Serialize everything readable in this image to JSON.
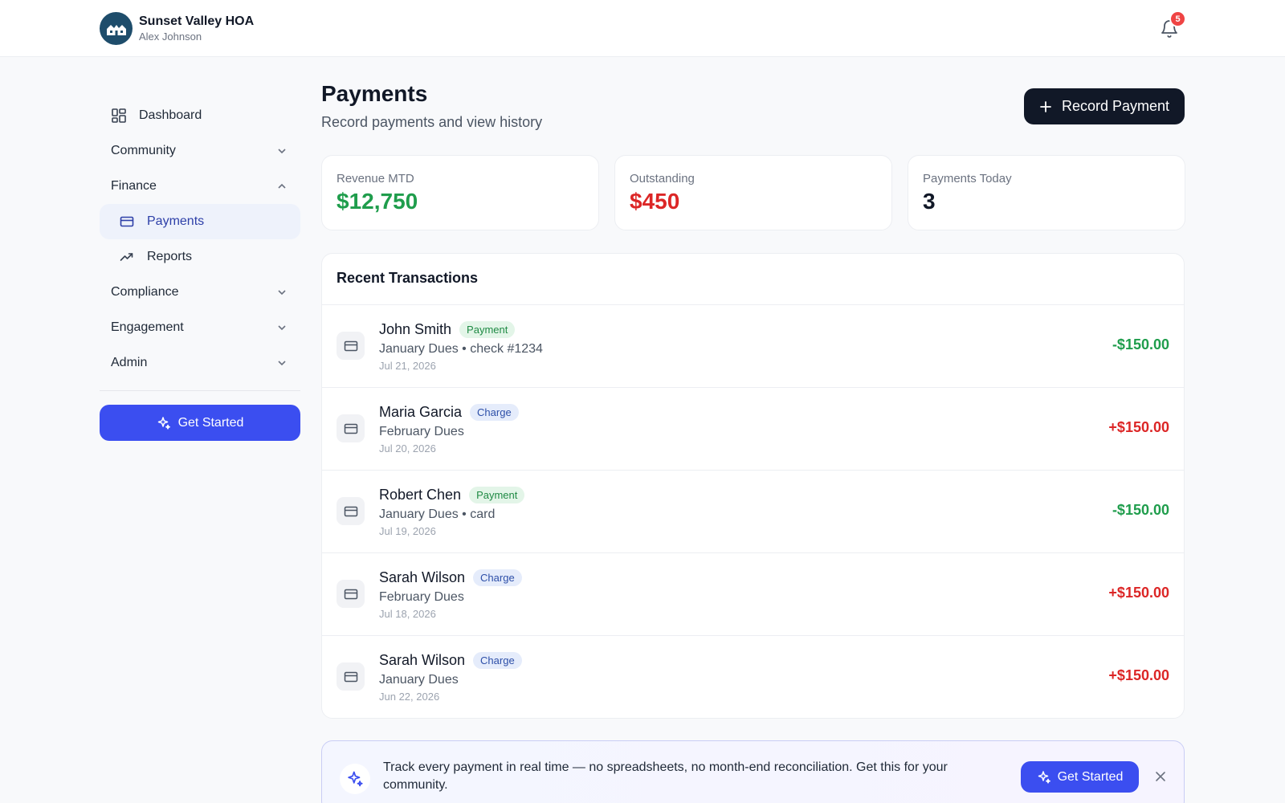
{
  "app": {
    "name": "Sunset Valley HOA",
    "user": "Alex Johnson",
    "notification_count": "5"
  },
  "sidebar": {
    "items": [
      {
        "label": "Dashboard",
        "icon": "dashboard-icon"
      },
      {
        "label": "Community",
        "icon": "chevron-down-icon"
      },
      {
        "label": "Finance",
        "icon": "chevron-up-icon"
      },
      {
        "label": "Payments",
        "icon": "credit-card-icon"
      },
      {
        "label": "Reports",
        "icon": "trending-up-icon"
      },
      {
        "label": "Compliance",
        "icon": "chevron-down-icon"
      },
      {
        "label": "Engagement",
        "icon": "chevron-down-icon"
      },
      {
        "label": "Admin",
        "icon": "chevron-down-icon"
      }
    ],
    "cta_label": "Get Started"
  },
  "page": {
    "title": "Payments",
    "subtitle": "Record payments and view history",
    "record_button": "Record Payment"
  },
  "stats": [
    {
      "label": "Revenue MTD",
      "value": "$12,750",
      "color": "#1f9d4c"
    },
    {
      "label": "Outstanding",
      "value": "$450",
      "color": "#dc2626"
    },
    {
      "label": "Payments Today",
      "value": "3",
      "color": "#111827"
    }
  ],
  "transactions": {
    "title": "Recent Transactions",
    "rows": [
      {
        "name": "John Smith",
        "tag": "Payment",
        "desc": "January Dues • check #1234",
        "date": "Jul 21, 2026",
        "amount": "-$150.00"
      },
      {
        "name": "Maria Garcia",
        "tag": "Charge",
        "desc": "February Dues",
        "date": "Jul 20, 2026",
        "amount": "+$150.00"
      },
      {
        "name": "Robert Chen",
        "tag": "Payment",
        "desc": "January Dues • card",
        "date": "Jul 19, 2026",
        "amount": "-$150.00"
      },
      {
        "name": "Sarah Wilson",
        "tag": "Charge",
        "desc": "February Dues",
        "date": "Jul 18, 2026",
        "amount": "+$150.00"
      },
      {
        "name": "Sarah Wilson",
        "tag": "Charge",
        "desc": "January Dues",
        "date": "Jun 22, 2026",
        "amount": "+$150.00"
      }
    ]
  },
  "promo": {
    "text": "Track every payment in real time — no spreadsheets, no month-end reconciliation. Get this for your community.",
    "button": "Get Started"
  },
  "colors": {
    "accent": "#3b4ef0",
    "positive": "#1f9d4c",
    "negative": "#dc2626",
    "dark_button": "#111827"
  }
}
